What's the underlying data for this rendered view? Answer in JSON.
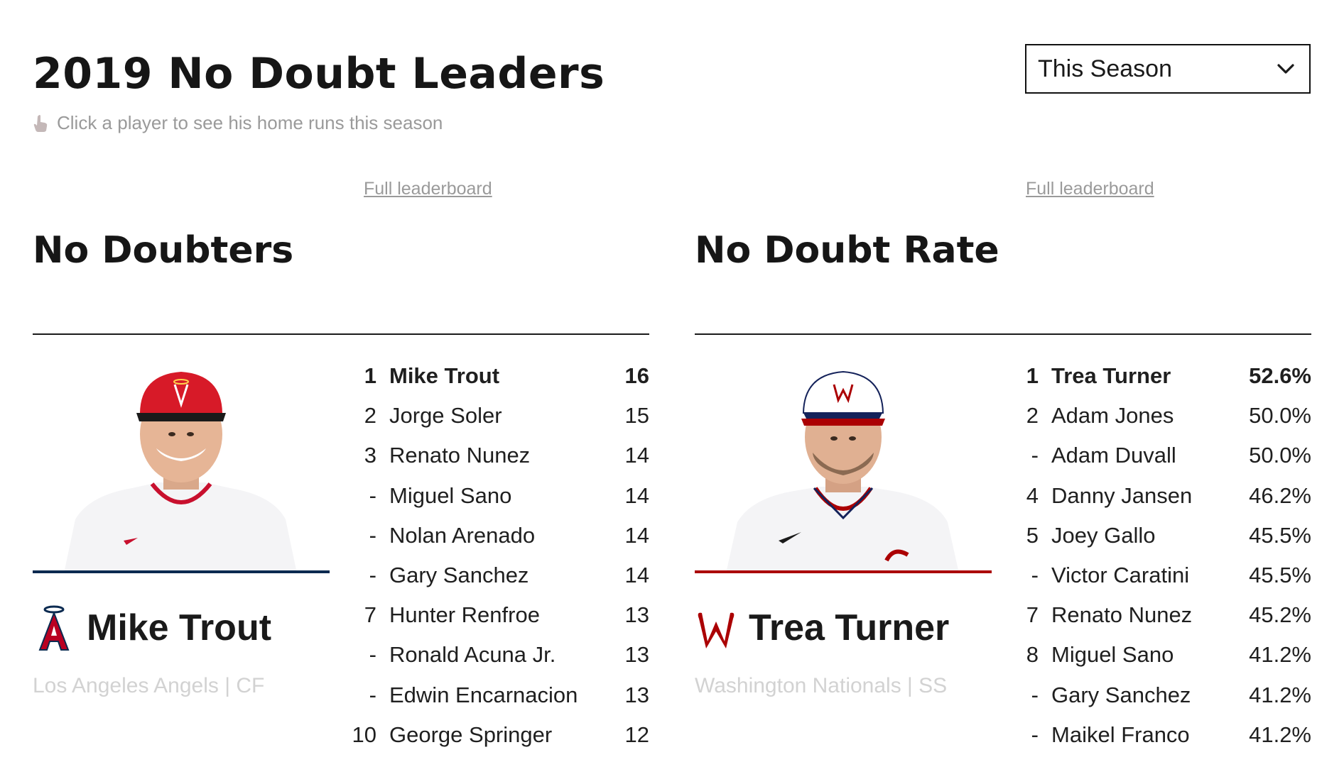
{
  "header": {
    "title": "2019 No Doubt Leaders",
    "hint": "Click a player to see his home runs this season",
    "season_select": {
      "selected": "This Season"
    }
  },
  "colors": {
    "angels_navy": "#0b2a50",
    "angels_red": "#ba0021",
    "nationals_red": "#ab0003"
  },
  "panels": {
    "left": {
      "link": "Full leaderboard",
      "title": "No Doubters",
      "featured": {
        "name": "Mike Trout",
        "team": "Los Angeles Angels | CF"
      },
      "rows": [
        {
          "rank": "1",
          "name": "Mike Trout",
          "value": "16"
        },
        {
          "rank": "2",
          "name": "Jorge Soler",
          "value": "15"
        },
        {
          "rank": "3",
          "name": "Renato Nunez",
          "value": "14"
        },
        {
          "rank": "-",
          "name": "Miguel Sano",
          "value": "14"
        },
        {
          "rank": "-",
          "name": "Nolan Arenado",
          "value": "14"
        },
        {
          "rank": "-",
          "name": "Gary Sanchez",
          "value": "14"
        },
        {
          "rank": "7",
          "name": "Hunter Renfroe",
          "value": "13"
        },
        {
          "rank": "-",
          "name": "Ronald Acuna Jr.",
          "value": "13"
        },
        {
          "rank": "-",
          "name": "Edwin Encarnacion",
          "value": "13"
        },
        {
          "rank": "10",
          "name": "George Springer",
          "value": "12"
        }
      ]
    },
    "right": {
      "link": "Full leaderboard",
      "title": "No Doubt Rate",
      "featured": {
        "name": "Trea Turner",
        "team": "Washington Nationals | SS"
      },
      "rows": [
        {
          "rank": "1",
          "name": "Trea Turner",
          "value": "52.6%"
        },
        {
          "rank": "2",
          "name": "Adam Jones",
          "value": "50.0%"
        },
        {
          "rank": "-",
          "name": "Adam Duvall",
          "value": "50.0%"
        },
        {
          "rank": "4",
          "name": "Danny Jansen",
          "value": "46.2%"
        },
        {
          "rank": "5",
          "name": "Joey Gallo",
          "value": "45.5%"
        },
        {
          "rank": "-",
          "name": "Victor Caratini",
          "value": "45.5%"
        },
        {
          "rank": "7",
          "name": "Renato Nunez",
          "value": "45.2%"
        },
        {
          "rank": "8",
          "name": "Miguel Sano",
          "value": "41.2%"
        },
        {
          "rank": "-",
          "name": "Gary Sanchez",
          "value": "41.2%"
        },
        {
          "rank": "-",
          "name": "Maikel Franco",
          "value": "41.2%"
        }
      ]
    }
  }
}
